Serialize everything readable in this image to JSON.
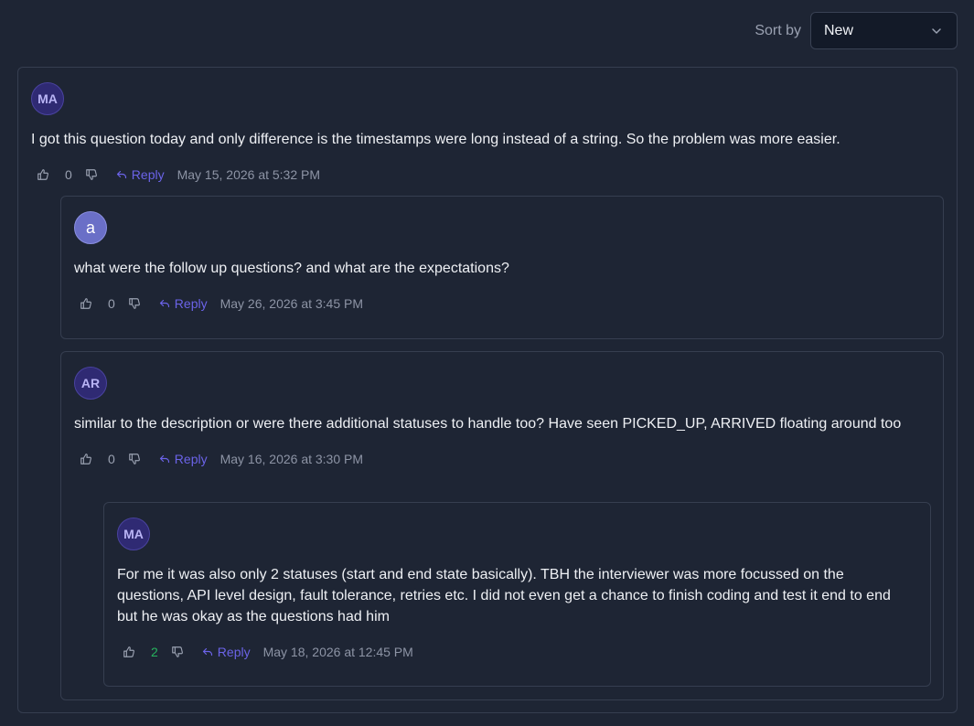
{
  "sort": {
    "label": "Sort by",
    "value": "New"
  },
  "colors": {
    "accent": "#6b63e8",
    "positive": "#27b35e",
    "background": "#1e2534"
  },
  "comments": [
    {
      "avatar": "MA",
      "text": "I got this question today and only difference is the timestamps were long instead of a string. So the problem was more easier.",
      "votes": "0",
      "reply_label": "Reply",
      "timestamp": "May 15, 2026 at 5:32 PM"
    },
    {
      "avatar": "a",
      "text": "what were the follow up questions? and what are the expectations?",
      "votes": "0",
      "reply_label": "Reply",
      "timestamp": "May 26, 2026 at 3:45 PM"
    },
    {
      "avatar": "AR",
      "text": "similar to the description or were there additional statuses to handle too? Have seen PICKED_UP, ARRIVED floating around too",
      "votes": "0",
      "reply_label": "Reply",
      "timestamp": "May 16, 2026 at 3:30 PM"
    },
    {
      "avatar": "MA",
      "text": "For me it was also only 2 statuses (start and end state basically). TBH the interviewer was more focussed on the questions, API level design, fault tolerance, retries etc. I did not even get a chance to finish coding and test it end to end but he was okay as the questions had him",
      "votes": "2",
      "reply_label": "Reply",
      "timestamp": "May 18, 2026 at 12:45 PM"
    }
  ]
}
